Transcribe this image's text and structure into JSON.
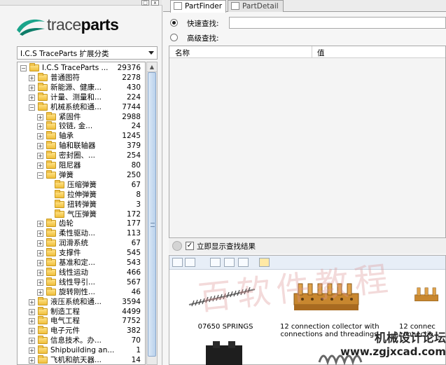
{
  "window_buttons": {
    "restore": "□",
    "close": "x"
  },
  "logo": {
    "text_light": "trace",
    "text_bold": "parts"
  },
  "category_select": {
    "value": "I.C.S TraceParts 扩展分类"
  },
  "tree": {
    "rows": [
      {
        "label": "I.C.S TraceParts ...",
        "count": "29376",
        "expander": "−"
      },
      {
        "label": "普通图符",
        "count": "2278",
        "expander": "+"
      },
      {
        "label": "新能源、健康...",
        "count": "430",
        "expander": "+"
      },
      {
        "label": "计量、测量和...",
        "count": "224",
        "expander": "+"
      },
      {
        "label": "机械系统和通...",
        "count": "7744",
        "expander": "−"
      },
      {
        "label": "紧固件",
        "count": "2988",
        "expander": "+"
      },
      {
        "label": "铰链, 金...",
        "count": "24",
        "expander": "+"
      },
      {
        "label": "轴承",
        "count": "1245",
        "expander": "+"
      },
      {
        "label": "轴和联轴器",
        "count": "379",
        "expander": "+"
      },
      {
        "label": "密封圈、...",
        "count": "254",
        "expander": "+"
      },
      {
        "label": "阻尼器",
        "count": "80",
        "expander": "+"
      },
      {
        "label": "弹簧",
        "count": "250",
        "expander": "−"
      },
      {
        "label": "压缩弹簧",
        "count": "67",
        "expander": ""
      },
      {
        "label": "拉伸弹簧",
        "count": "8",
        "expander": ""
      },
      {
        "label": "扭转弹簧",
        "count": "3",
        "expander": ""
      },
      {
        "label": "气压弹簧",
        "count": "172",
        "expander": ""
      },
      {
        "label": "齿轮",
        "count": "177",
        "expander": "+"
      },
      {
        "label": "柔性驱动...",
        "count": "113",
        "expander": "+"
      },
      {
        "label": "润滑系统",
        "count": "67",
        "expander": "+"
      },
      {
        "label": "支撑件",
        "count": "545",
        "expander": "+"
      },
      {
        "label": "基准和定...",
        "count": "543",
        "expander": "+"
      },
      {
        "label": "线性运动",
        "count": "466",
        "expander": "+"
      },
      {
        "label": "线性导引...",
        "count": "567",
        "expander": "+"
      },
      {
        "label": "旋转刚性...",
        "count": "46",
        "expander": "+"
      },
      {
        "label": "液压系统和通...",
        "count": "3594",
        "expander": "+"
      },
      {
        "label": "制造工程",
        "count": "4499",
        "expander": "+"
      },
      {
        "label": "电气工程",
        "count": "7752",
        "expander": "+"
      },
      {
        "label": "电子元件",
        "count": "382",
        "expander": "+"
      },
      {
        "label": "信息技术。办...",
        "count": "70",
        "expander": "+"
      },
      {
        "label": "Shipbuilding an...",
        "count": "1",
        "expander": "+"
      },
      {
        "label": "飞机和航天器...",
        "count": "14",
        "expander": "+"
      }
    ]
  },
  "tabs": {
    "part_finder": "PartFinder",
    "part_detail": "PartDetail"
  },
  "search": {
    "quick_label": "快速查找:",
    "advanced_label": "高级查找:",
    "quick_value": ""
  },
  "grid": {
    "col_name": "名称",
    "col_value": "值"
  },
  "show_results": {
    "label": "立即显示查找结果",
    "checked": "✓"
  },
  "results": [
    {
      "caption": "07650 SPRINGS"
    },
    {
      "caption": "12 connection collector with",
      "caption2": "connections and threadings"
    },
    {
      "caption": "12 connec",
      "caption2": "connectio"
    }
  ],
  "watermark": {
    "text": "百软件教程",
    "site_cn": "机械设计论坛",
    "site_url": "www.zgjxcad.com"
  }
}
